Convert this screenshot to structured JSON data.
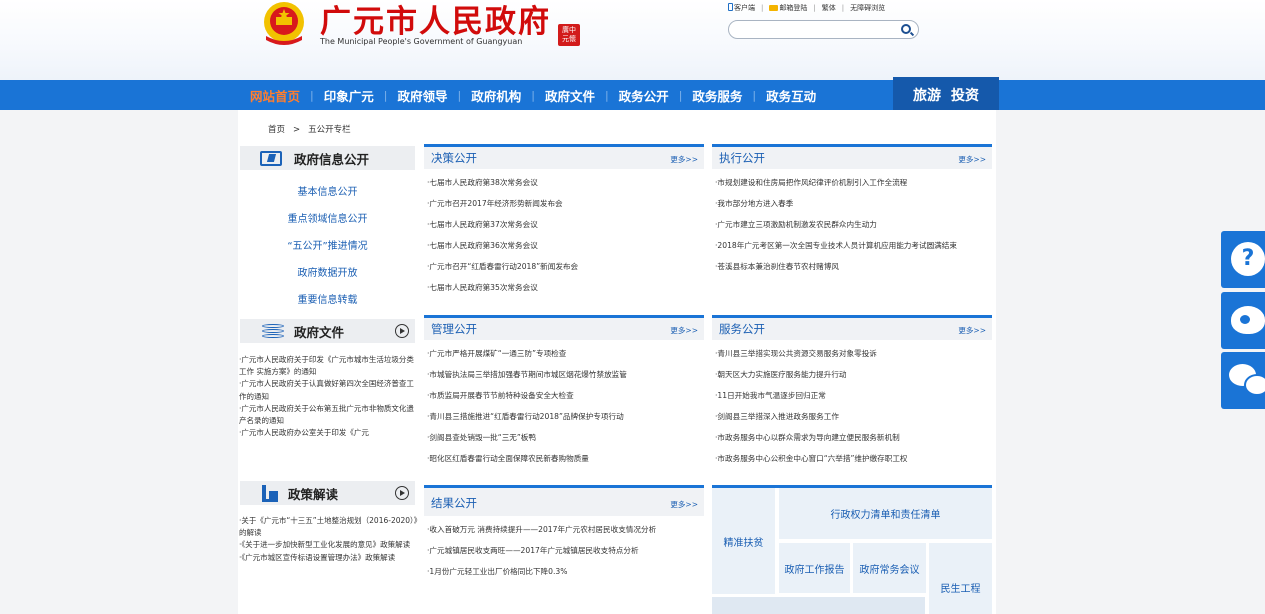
{
  "header": {
    "logo_cn": "广元市人民政府",
    "logo_en": "The Municipal People's Government of Guangyuan",
    "seal_text": "廣中元懷",
    "top_links": [
      "客户端",
      "邮箱登陆",
      "繁体",
      "无障碍浏览"
    ],
    "search_placeholder": ""
  },
  "nav": {
    "items": [
      "网站首页",
      "印象广元",
      "政府领导",
      "政府机构",
      "政府文件",
      "政务公开",
      "政务服务",
      "政务互动"
    ],
    "special": [
      "旅游",
      "投资"
    ]
  },
  "breadcrumb": {
    "home": "首页",
    "sep": ">",
    "current": "五公开专栏"
  },
  "sidebar": {
    "info_title": "政府信息公开",
    "info_links": [
      "基本信息公开",
      "重点领域信息公开",
      "“五公开”推进情况",
      "政府数据开放",
      "重要信息转载"
    ],
    "docs_title": "政府文件",
    "docs": [
      "·广元市人民政府关于印发《广元市城市生活垃圾分类工作 实施方案》的通知",
      "·广元市人民政府关于认真做好第四次全国经济普查工作的通知",
      "·广元市人民政府关于公布第五批广元市非物质文化遗产名录的通知",
      "·广元市人民政府办公室关于印发《广元"
    ],
    "policy_title": "政策解读",
    "policies": [
      "·关于《广元市“十三五”土地整治规划（2016-2020）》的解读",
      "·《关于进一步加快新型工业化发展的意见》政策解读",
      "·《广元市城区宣传标语设置管理办法》政策解读"
    ]
  },
  "panels": {
    "decision": {
      "title": "决策公开",
      "more": "更多>>",
      "items": [
        "·七届市人民政府第38次常务会议",
        "·广元市召开2017年经济形势新闻发布会",
        "·七届市人民政府第37次常务会议",
        "·七届市人民政府第36次常务会议",
        "·广元市召开“红盾春雷行动2018”新闻发布会",
        "·七届市人民政府第35次常务会议"
      ]
    },
    "execution": {
      "title": "执行公开",
      "more": "更多>>",
      "items": [
        "·市规划建设和住房局把作风纪律评价机制引入工作全流程",
        "·我市部分地方进入春季",
        "·广元市建立三项激励机制激发农民群众内生动力",
        "·2018年广元考区第一次全国专业技术人员计算机应用能力考试圆满结束",
        "·苍溪县标本兼治刹住春节农村赌博风"
      ]
    },
    "management": {
      "title": "管理公开",
      "more": "更多>>",
      "items": [
        "·广元市严格开展煤矿“一通三防”专项检查",
        "·市城管执法局三举措加强春节期间市城区烟花爆竹禁放监管",
        "·市质监局开展春节节前特种设备安全大检查",
        "·青川县三措施推进“红盾春雷行动2018”品牌保护专项行动",
        "·剑阁县查处销毁一批“三无”板鸭",
        "·昭化区红盾春雷行动全面保障农民新春购物质量"
      ]
    },
    "service": {
      "title": "服务公开",
      "more": "更多>>",
      "items": [
        "·青川县三举措实现公共资源交易服务对象零投诉",
        "·朝天区大力实施医疗服务能力提升行动",
        "·11日开始我市气温逐步回归正常",
        "·剑阁县三举措深入推进政务服务工作",
        "·市政务服务中心以群众需求为导向建立便民服务新机制",
        "·市政务服务中心公积金中心窗口“六举措”维护缴存职工权"
      ]
    },
    "result": {
      "title": "结果公开",
      "more": "更多>>",
      "items": [
        "·收入首破万元 消费持续提升——2017年广元农村居民收支情况分析",
        "·广元城镇居民收支两旺——2017年广元城镇居民收支特点分析",
        "·1月份广元轻工业出厂价格同比下降0.3%"
      ]
    }
  },
  "tiles": {
    "poverty": "精准扶贫",
    "power_list": "行政权力清单和责任清单",
    "work_report": "政府工作报告",
    "exec_meeting": "政府常务会议",
    "livelihood": "民生工程"
  },
  "float": [
    "help-icon",
    "weibo-icon",
    "wechat-icon"
  ]
}
